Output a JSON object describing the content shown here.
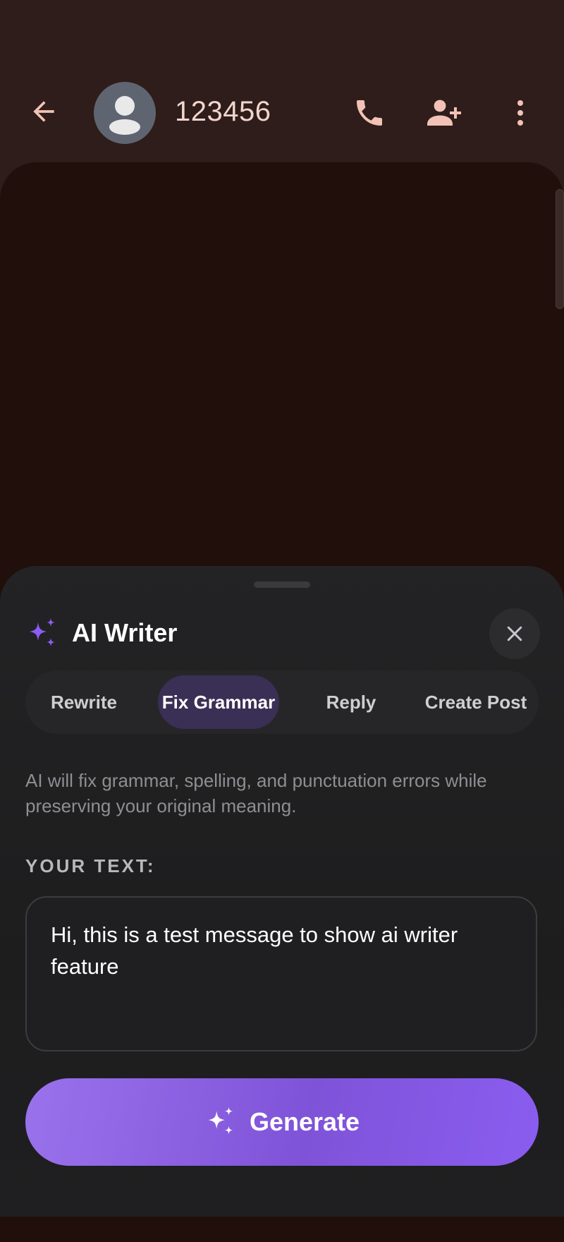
{
  "conversation": {
    "contact_name": "123456"
  },
  "icons": {
    "back": "arrow-left-icon",
    "avatar": "person-icon",
    "call": "phone-icon",
    "add_contact": "person-add-icon",
    "more": "more-vertical-icon",
    "ai": "sparkle-icon",
    "close": "close-icon"
  },
  "colors": {
    "accent": "#8b5cf6",
    "top_icon": "#f2c2b6",
    "active_tab": "#3a2f54"
  },
  "ai_writer": {
    "title": "AI Writer",
    "tabs": [
      {
        "label": "Rewrite",
        "active": false
      },
      {
        "label": "Fix Grammar",
        "active": true
      },
      {
        "label": "Reply",
        "active": false
      },
      {
        "label": "Create Post",
        "active": false
      }
    ],
    "description": "AI will fix grammar, spelling, and punctuation errors while preserving your original meaning.",
    "input_label": "YOUR TEXT:",
    "input_value": "Hi, this is a test message to show ai writer feature",
    "generate_label": "Generate"
  }
}
